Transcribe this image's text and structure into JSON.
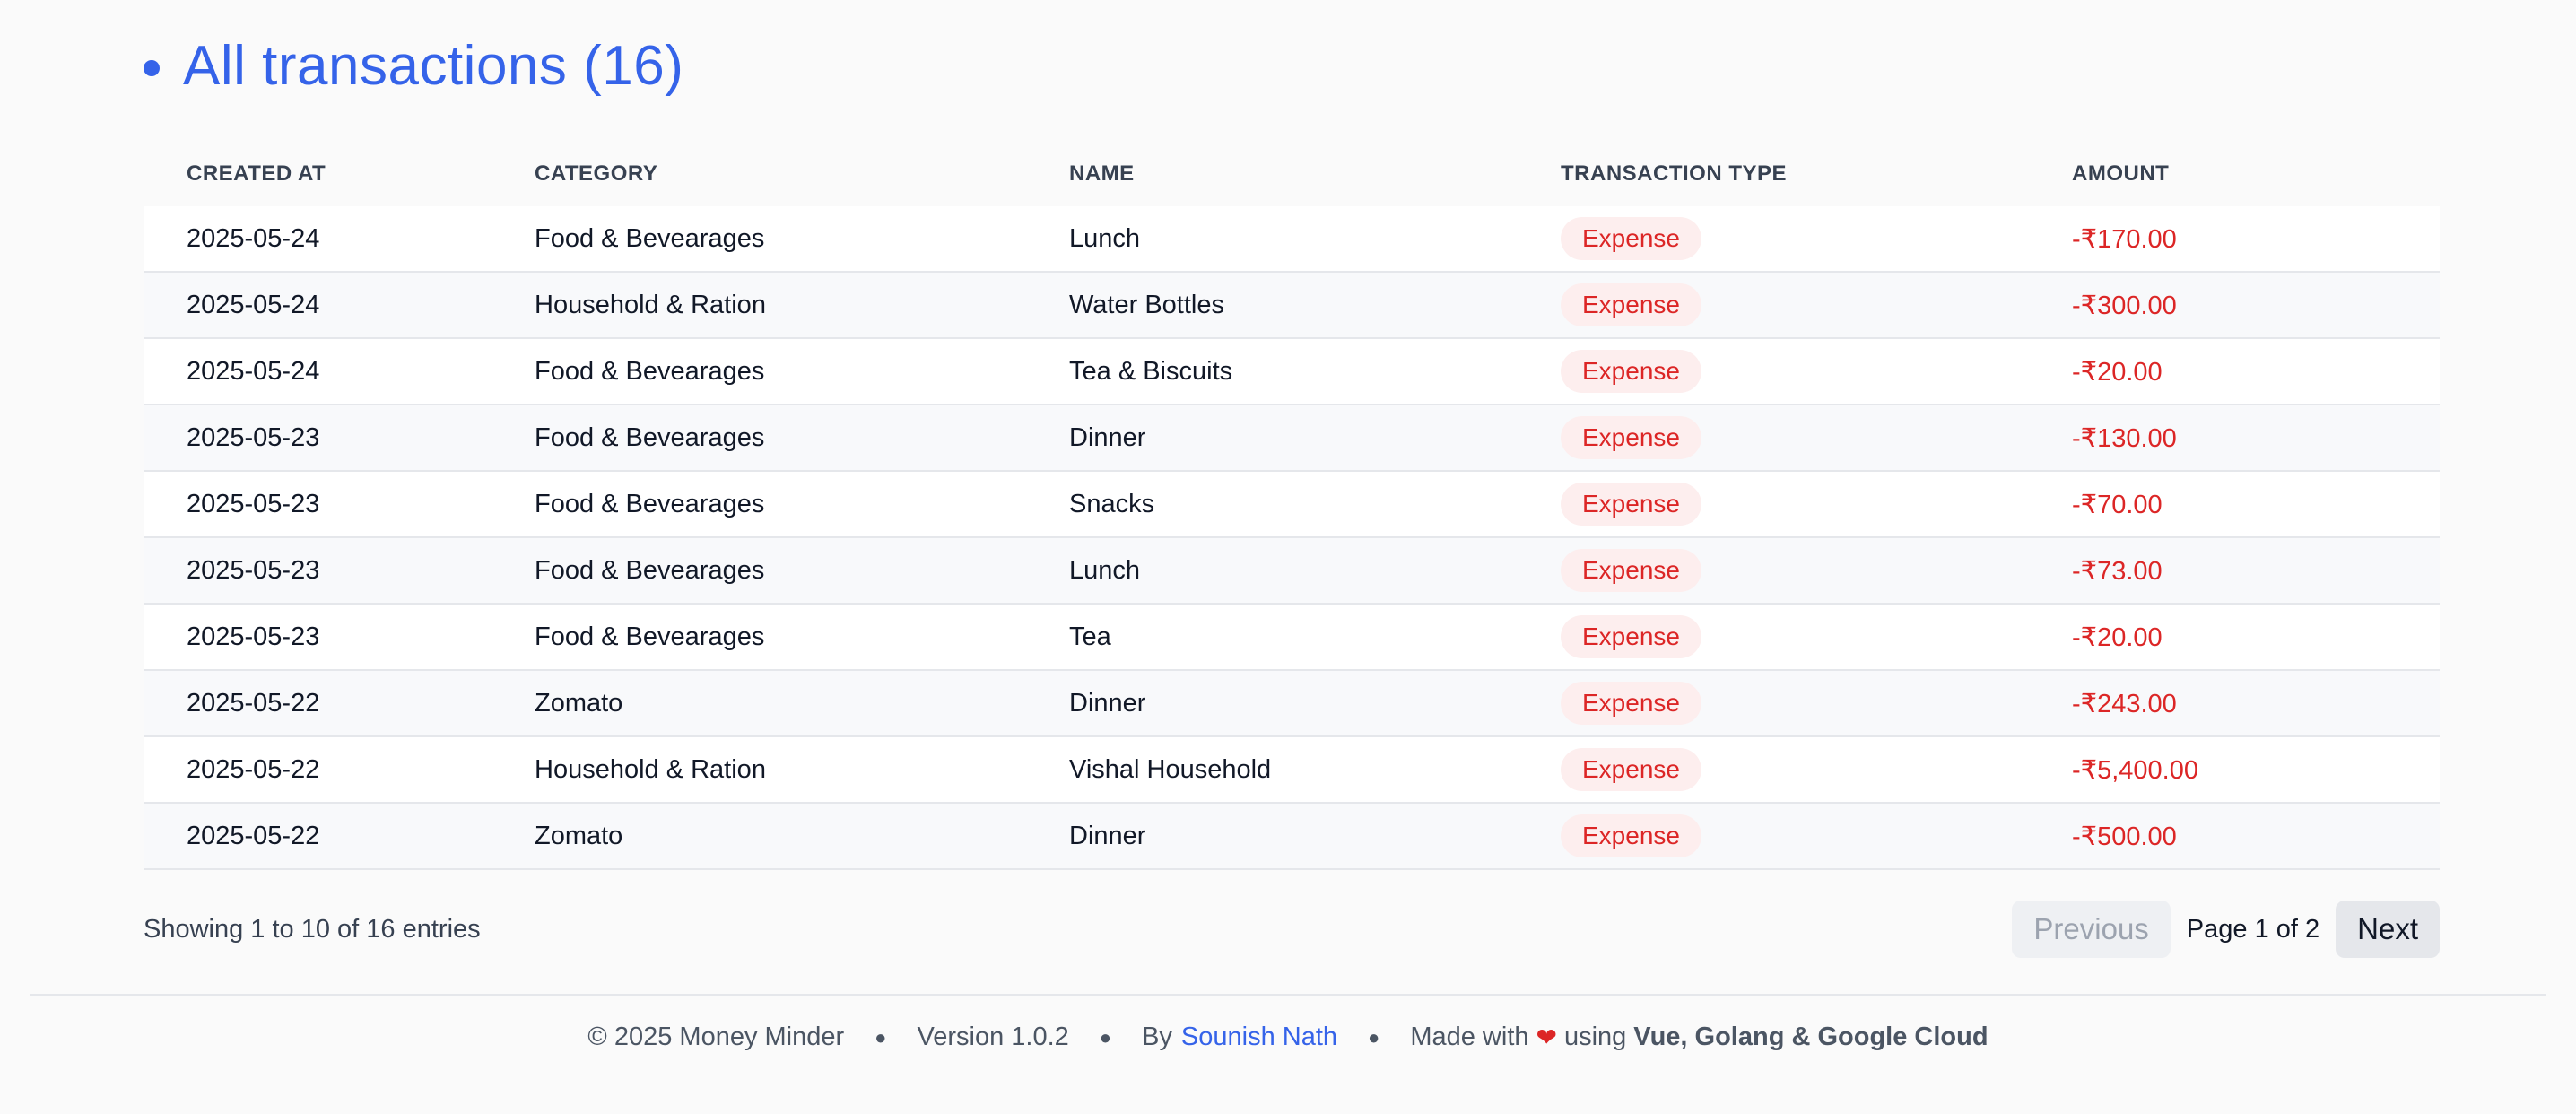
{
  "header": {
    "title": "All transactions (16)"
  },
  "table": {
    "columns": [
      "CREATED AT",
      "CATEGORY",
      "NAME",
      "TRANSACTION TYPE",
      "AMOUNT"
    ],
    "rows": [
      {
        "created_at": "2025-05-24",
        "category": "Food & Bevearages",
        "name": "Lunch",
        "type": "Expense",
        "amount": "-₹170.00"
      },
      {
        "created_at": "2025-05-24",
        "category": "Household & Ration",
        "name": "Water Bottles",
        "type": "Expense",
        "amount": "-₹300.00"
      },
      {
        "created_at": "2025-05-24",
        "category": "Food & Bevearages",
        "name": "Tea & Biscuits",
        "type": "Expense",
        "amount": "-₹20.00"
      },
      {
        "created_at": "2025-05-23",
        "category": "Food & Bevearages",
        "name": "Dinner",
        "type": "Expense",
        "amount": "-₹130.00"
      },
      {
        "created_at": "2025-05-23",
        "category": "Food & Bevearages",
        "name": "Snacks",
        "type": "Expense",
        "amount": "-₹70.00"
      },
      {
        "created_at": "2025-05-23",
        "category": "Food & Bevearages",
        "name": "Lunch",
        "type": "Expense",
        "amount": "-₹73.00"
      },
      {
        "created_at": "2025-05-23",
        "category": "Food & Bevearages",
        "name": "Tea",
        "type": "Expense",
        "amount": "-₹20.00"
      },
      {
        "created_at": "2025-05-22",
        "category": "Zomato",
        "name": "Dinner",
        "type": "Expense",
        "amount": "-₹243.00"
      },
      {
        "created_at": "2025-05-22",
        "category": "Household & Ration",
        "name": "Vishal Household",
        "type": "Expense",
        "amount": "-₹5,400.00"
      },
      {
        "created_at": "2025-05-22",
        "category": "Zomato",
        "name": "Dinner",
        "type": "Expense",
        "amount": "-₹500.00"
      }
    ]
  },
  "pagination": {
    "showing": "Showing 1 to 10 of 16 entries",
    "previous_label": "Previous",
    "page_info": "Page 1 of 2",
    "next_label": "Next"
  },
  "footer": {
    "copyright": "© 2025 Money Minder",
    "version": "Version 1.0.2",
    "by_label": "By",
    "author": "Sounish Nath",
    "made_with": "Made with",
    "heart_icon": "heart-icon",
    "using": "using",
    "tech": "Vue, Golang & Google Cloud"
  },
  "colors": {
    "accent": "#3563e9",
    "expense": "#dc2626",
    "expense_badge_bg": "#fdeeee"
  }
}
